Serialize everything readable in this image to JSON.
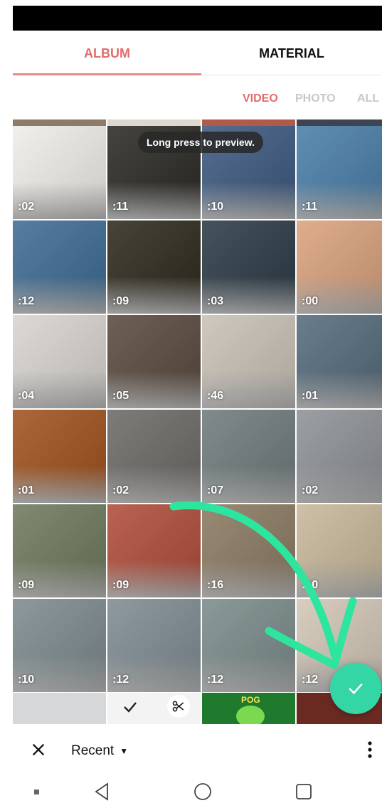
{
  "tabs": {
    "album": "ALBUM",
    "material": "MATERIAL"
  },
  "filters": {
    "video": "VIDEO",
    "photo": "PHOTO",
    "all": "ALL"
  },
  "tooltip": "Long press to preview.",
  "grid": {
    "items": [
      {
        "duration": ":02",
        "bg": "#f0ede8"
      },
      {
        "duration": ":11",
        "bg": "#2b2a25"
      },
      {
        "duration": ":10",
        "bg": "#3d5a80"
      },
      {
        "duration": ":11",
        "bg": "#4a7ea8"
      },
      {
        "duration": ":12",
        "bg": "#3e6c93"
      },
      {
        "duration": ":09",
        "bg": "#2f2a1e"
      },
      {
        "duration": ":03",
        "bg": "#2c3b46"
      },
      {
        "duration": ":00",
        "bg": "#d9a27d"
      },
      {
        "duration": ":04",
        "bg": "#d8d4cf"
      },
      {
        "duration": ":05",
        "bg": "#5a4a3e"
      },
      {
        "duration": ":46",
        "bg": "#c9c1b6"
      },
      {
        "duration": ":01",
        "bg": "#556b7c"
      },
      {
        "duration": ":01",
        "bg": "#a0521e"
      },
      {
        "duration": ":02",
        "bg": "#6d6a66"
      },
      {
        "duration": ":07",
        "bg": "#6f7b7c"
      },
      {
        "duration": ":02",
        "bg": "#8e9297"
      },
      {
        "duration": ":09",
        "bg": "#6e7a5d"
      },
      {
        "duration": ":09",
        "bg": "#b04d3a"
      },
      {
        "duration": ":16",
        "bg": "#8b7a62"
      },
      {
        "duration": ":10",
        "bg": "#c8b89a"
      },
      {
        "duration": ":10",
        "bg": "#7d8a8e"
      },
      {
        "duration": ":12",
        "bg": "#7f8b93"
      },
      {
        "duration": ":12",
        "bg": "#7b8b8a"
      },
      {
        "duration": ":12",
        "bg": "#d2c6b6"
      }
    ]
  },
  "bottom_peek": {
    "pog_label": "POG"
  },
  "bottom_bar": {
    "recent_label": "Recent"
  },
  "colors": {
    "accent": "#e26b6b",
    "fab": "#35d6a6",
    "gesture": "#2ee5a0"
  },
  "icons": [
    "close-icon",
    "caret-down-icon",
    "more-vert-icon",
    "check-icon",
    "scissors-icon",
    "nav-back-icon",
    "nav-home-icon",
    "nav-recents-icon",
    "nav-dot-icon"
  ]
}
